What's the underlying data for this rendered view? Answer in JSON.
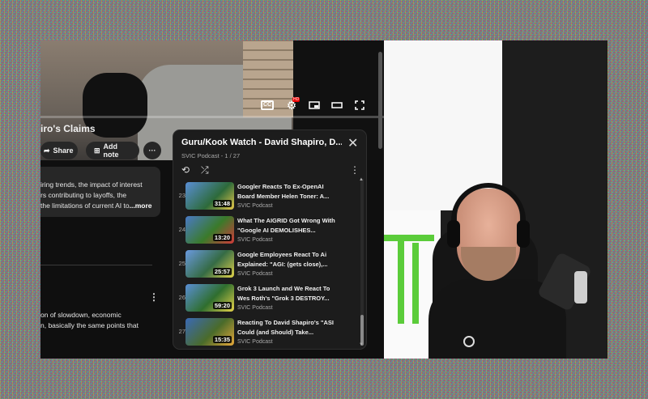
{
  "video": {
    "title": "iro's Claims",
    "controls": {
      "cc": "CC",
      "hd": "HD"
    }
  },
  "actions": {
    "share_label": "Share",
    "add_note_label": "Add note",
    "more_label": "···"
  },
  "description": {
    "lines": [
      "iring trends, the impact of interest",
      "rs contributing to layoffs, the",
      " the limitations of current AI to"
    ],
    "more_label": "...more"
  },
  "comment": {
    "lines": [
      "on of slowdown, economic",
      "n, basically the same points that"
    ]
  },
  "playlist": {
    "title": "Guru/Kook Watch - David Shapiro, D...",
    "subtitle": "SVIC Podcast - 1 / 27",
    "items": [
      {
        "index": "23",
        "title": "Googler Reacts To Ex-OpenAI Board Member Helen Toner: A...",
        "channel": "SVIC Podcast",
        "duration": "31:48",
        "thumb_color": "#2d6a3a"
      },
      {
        "index": "24",
        "title": "What The AIGRID Got Wrong With \"Google AI DEMOLISHES...",
        "channel": "SVIC Podcast",
        "duration": "13:20",
        "thumb_color": "#3a7a2a"
      },
      {
        "index": "25",
        "title": "Google Employees React To Ai Explained: \"AGI: (gets close),...",
        "channel": "SVIC Podcast",
        "duration": "25:57",
        "thumb_color": "#356b45"
      },
      {
        "index": "26",
        "title": "Grok 3 Launch and We React To Wes Roth's \"Grok 3 DESTROY...",
        "channel": "SVIC Podcast",
        "duration": "59:20",
        "thumb_color": "#2f6e2e"
      },
      {
        "index": "27",
        "title": "Reacting To David Shapiro's \"ASI Could (and Should) Take...",
        "channel": "SVIC Podcast",
        "duration": "15:35",
        "thumb_color": "#4a6b2a"
      }
    ]
  },
  "icons": {
    "close": "✕",
    "loop": "⟲",
    "shuffle": "⤮",
    "kebab": "⋮",
    "share": "➦",
    "add_note": "⊞"
  }
}
